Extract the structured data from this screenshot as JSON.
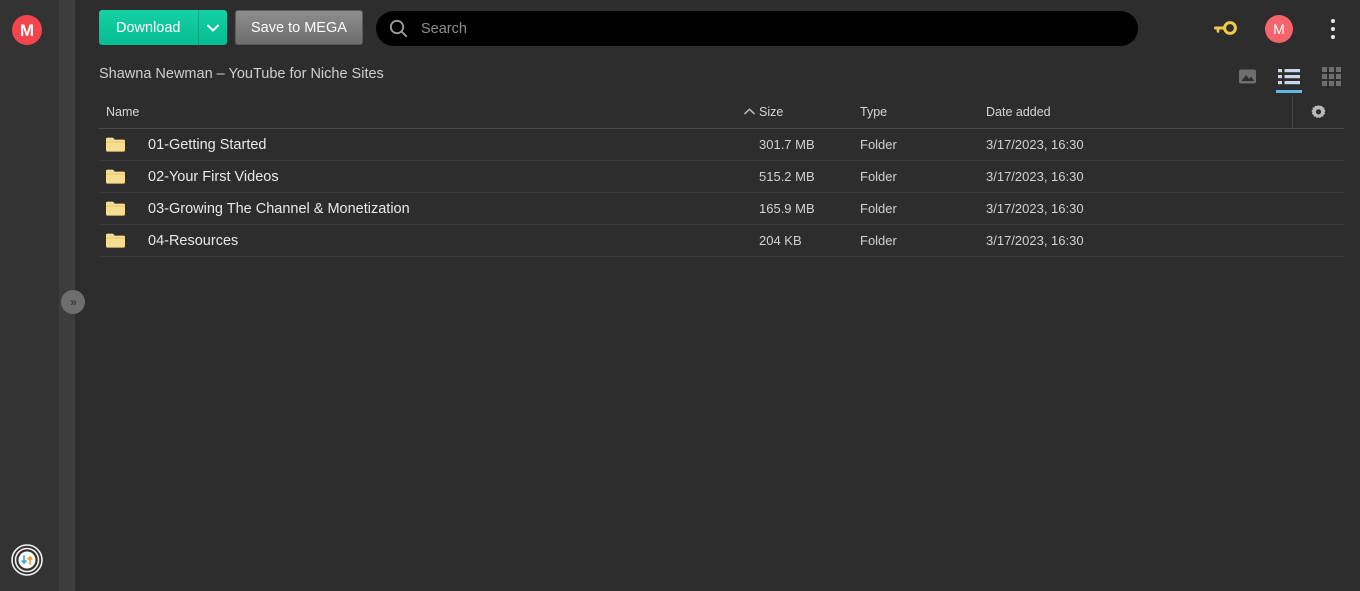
{
  "rail": {
    "mega_logo_letter": "M",
    "transfer_widget_icon": "transfer-status-icon",
    "collapse_handle_label": "»"
  },
  "toolbar": {
    "download_label": "Download",
    "download_caret_icon": "chevron-down-icon",
    "save_to_mega_label": "Save to MEGA",
    "key_icon": "key-icon",
    "kebab_icon": "more-vertical-icon",
    "user_avatar_letter": "M"
  },
  "search": {
    "placeholder": "Search",
    "value": "",
    "icon": "search-icon"
  },
  "breadcrumb": {
    "title": "Shawna Newman – YouTube for Niche Sites"
  },
  "view_toggles": [
    {
      "name": "media-view",
      "icon": "image-icon",
      "active": false
    },
    {
      "name": "list-view",
      "icon": "list-icon",
      "active": true
    },
    {
      "name": "grid-view",
      "icon": "grid-icon",
      "active": false
    }
  ],
  "table": {
    "columns": {
      "name": "Name",
      "size": "Size",
      "type": "Type",
      "date_added": "Date added"
    },
    "sort_indicator_icon": "chevron-up-icon",
    "settings_icon": "gear-icon",
    "rows": [
      {
        "name": "01-Getting Started",
        "size": "301.7 MB",
        "type": "Folder",
        "date_added": "3/17/2023, 16:30",
        "icon": "folder-icon"
      },
      {
        "name": "02-Your First Videos",
        "size": "515.2 MB",
        "type": "Folder",
        "date_added": "3/17/2023, 16:30",
        "icon": "folder-icon"
      },
      {
        "name": "03-Growing The Channel & Monetization",
        "size": "165.9 MB",
        "type": "Folder",
        "date_added": "3/17/2023, 16:30",
        "icon": "folder-icon"
      },
      {
        "name": "04-Resources",
        "size": "204 KB",
        "type": "Folder",
        "date_added": "3/17/2023, 16:30",
        "icon": "folder-icon"
      }
    ]
  },
  "colors": {
    "background": "#2d2d2d",
    "rail": "#333333",
    "accent_green": "#04bd91",
    "brand_red": "#f6444c",
    "folder_yellow": "#f7d77c",
    "active_underline": "#60b8e8",
    "key_yellow": "#f2c94c"
  }
}
